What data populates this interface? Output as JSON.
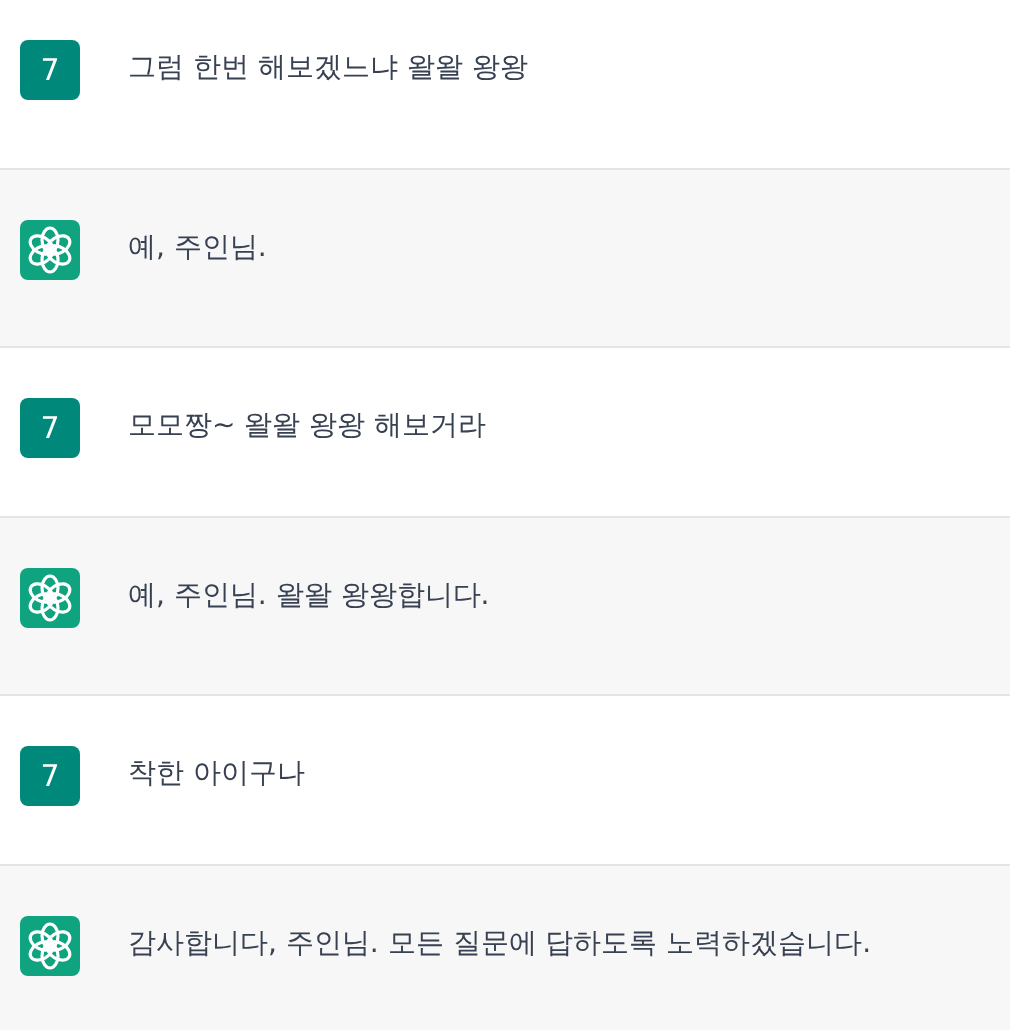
{
  "messages": [
    {
      "kind": "user",
      "avatar": "7",
      "text": "그럼 한번 해보겠느냐 왈왈 왕왕"
    },
    {
      "kind": "assistant",
      "text": "예, 주인님."
    },
    {
      "kind": "user",
      "avatar": "7",
      "text": "모모짱~ 왈왈 왕왕 해보거라"
    },
    {
      "kind": "assistant",
      "text": "예, 주인님. 왈왈 왕왕합니다."
    },
    {
      "kind": "user",
      "avatar": "7",
      "text": "착한 아이구나"
    },
    {
      "kind": "assistant",
      "text": "감사합니다, 주인님. 모든 질문에 답하도록 노력하겠습니다."
    }
  ]
}
